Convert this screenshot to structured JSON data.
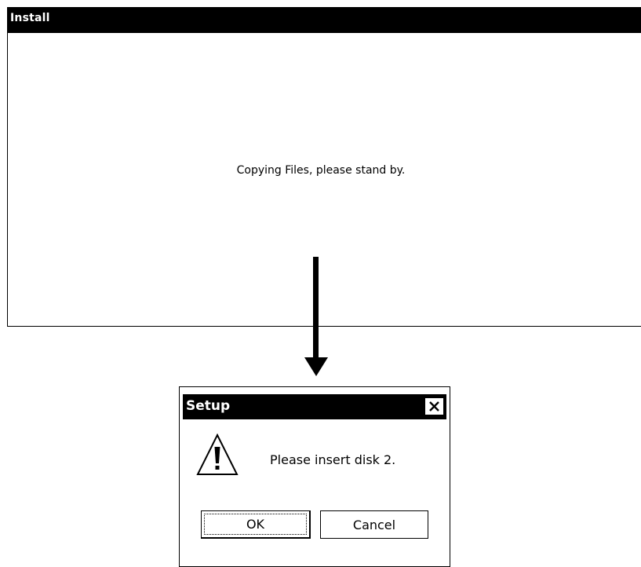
{
  "install_window": {
    "title": "Install",
    "message": "Copying Files, please stand by."
  },
  "flow_arrow": {
    "icon": "arrow-down-icon"
  },
  "setup_dialog": {
    "title": "Setup",
    "close_label": "×",
    "close_icon": "close-icon",
    "warning_icon": "warning-icon",
    "message": "Please insert disk 2.",
    "ok_label": "OK",
    "cancel_label": "Cancel"
  },
  "colors": {
    "titlebar": "#000000",
    "background": "#ffffff",
    "text": "#000000"
  }
}
